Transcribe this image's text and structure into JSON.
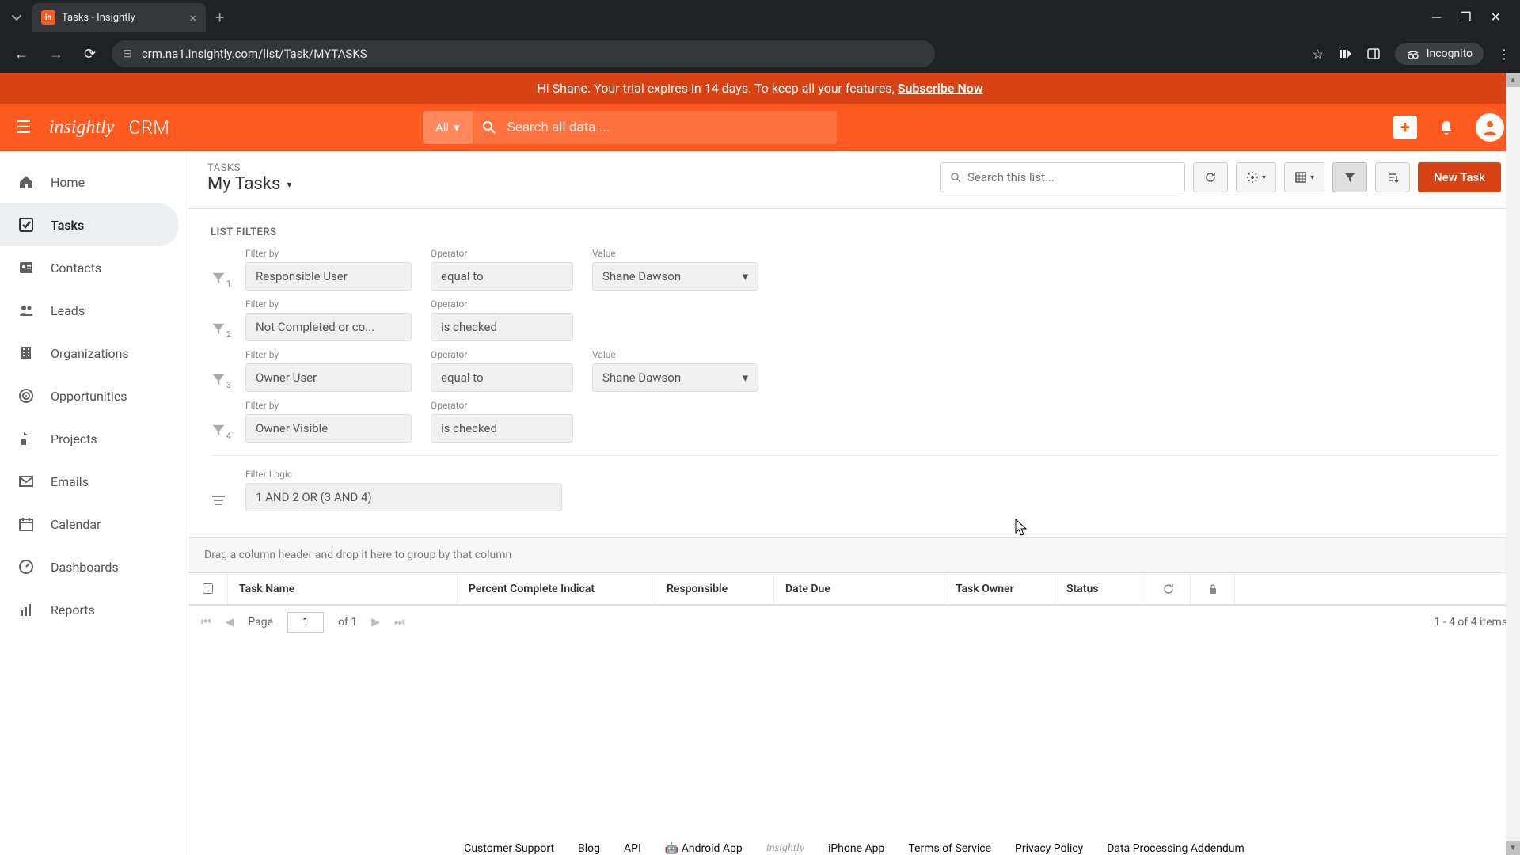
{
  "browser": {
    "tab_title": "Tasks - Insightly",
    "url": "crm.na1.insightly.com/list/Task/MYTASKS",
    "incognito_label": "Incognito"
  },
  "trial_banner": {
    "greeting": "Hi Shane. Your trial expires in 14 days. To keep all your features, ",
    "cta": "Subscribe Now"
  },
  "header": {
    "logo_text": "insightly",
    "product": "CRM",
    "scope_label": "All",
    "search_placeholder": "Search all data...."
  },
  "sidebar": {
    "items": [
      {
        "label": "Home"
      },
      {
        "label": "Tasks"
      },
      {
        "label": "Contacts"
      },
      {
        "label": "Leads"
      },
      {
        "label": "Organizations"
      },
      {
        "label": "Opportunities"
      },
      {
        "label": "Projects"
      },
      {
        "label": "Emails"
      },
      {
        "label": "Calendar"
      },
      {
        "label": "Dashboards"
      },
      {
        "label": "Reports"
      }
    ]
  },
  "list": {
    "breadcrumb": "TASKS",
    "title": "My Tasks",
    "search_placeholder": "Search this list...",
    "new_task_label": "New Task"
  },
  "filters": {
    "title": "LIST FILTERS",
    "rows": [
      {
        "num": "1",
        "filter_by_label": "Filter by",
        "filter_by": "Responsible User",
        "op_label": "Operator",
        "op": "equal to",
        "val_label": "Value",
        "val": "Shane Dawson"
      },
      {
        "num": "2",
        "filter_by_label": "Filter by",
        "filter_by": "Not Completed or co...",
        "op_label": "Operator",
        "op": "is checked"
      },
      {
        "num": "3",
        "filter_by_label": "Filter by",
        "filter_by": "Owner User",
        "op_label": "Operator",
        "op": "equal to",
        "val_label": "Value",
        "val": "Shane Dawson"
      },
      {
        "num": "4",
        "filter_by_label": "Filter by",
        "filter_by": "Owner Visible",
        "op_label": "Operator",
        "op": "is checked"
      }
    ],
    "logic_label": "Filter Logic",
    "logic_value": "1 AND 2 OR (3 AND 4)"
  },
  "grid": {
    "group_hint": "Drag a column header and drop it here to group by that column",
    "columns": {
      "task_name": "Task Name",
      "percent": "Percent Complete Indicat",
      "responsible": "Responsible",
      "date_due": "Date Due",
      "task_owner": "Task Owner",
      "status": "Status"
    },
    "pager": {
      "page_label": "Page",
      "page": "1",
      "of_label": "of 1",
      "items_label": "1 - 4 of 4 items"
    }
  },
  "footer": {
    "links": {
      "support": "Customer Support",
      "blog": "Blog",
      "api": "API",
      "android": "Android App",
      "logo": "insightly",
      "iphone": "iPhone App",
      "terms": "Terms of Service",
      "privacy": "Privacy Policy",
      "dpa": "Data Processing Addendum"
    }
  }
}
